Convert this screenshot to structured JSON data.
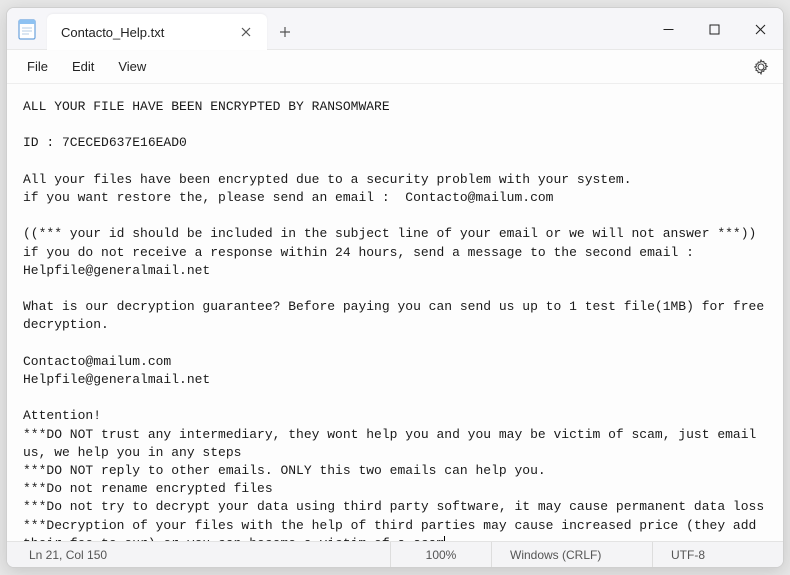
{
  "titlebar": {
    "tab_title": "Contacto_Help.txt"
  },
  "menu": {
    "file": "File",
    "edit": "Edit",
    "view": "View"
  },
  "content": {
    "text": "ALL YOUR FILE HAVE BEEN ENCRYPTED BY RANSOMWARE\n\nID : 7CECED637E16EAD0\n\nAll your files have been encrypted due to a security problem with your system.\nif you want restore the, please send an email :  Contacto@mailum.com\n\n((*** your id should be included in the subject line of your email or we will not answer ***))\nif you do not receive a response within 24 hours, send a message to the second email :\nHelpfile@generalmail.net\n\nWhat is our decryption guarantee? Before paying you can send us up to 1 test file(1MB) for free decryption.\n\nContacto@mailum.com\nHelpfile@generalmail.net\n\nAttention!\n***DO NOT trust any intermediary, they wont help you and you may be victim of scam, just email us, we help you in any steps\n***DO NOT reply to other emails. ONLY this two emails can help you.\n***Do not rename encrypted files\n***Do not try to decrypt your data using third party software, it may cause permanent data loss\n***Decryption of your files with the help of third parties may cause increased price (they add their fee to our) or you can become a victim of a scam"
  },
  "statusbar": {
    "position": "Ln 21, Col 150",
    "zoom": "100%",
    "eol": "Windows (CRLF)",
    "encoding": "UTF-8"
  }
}
